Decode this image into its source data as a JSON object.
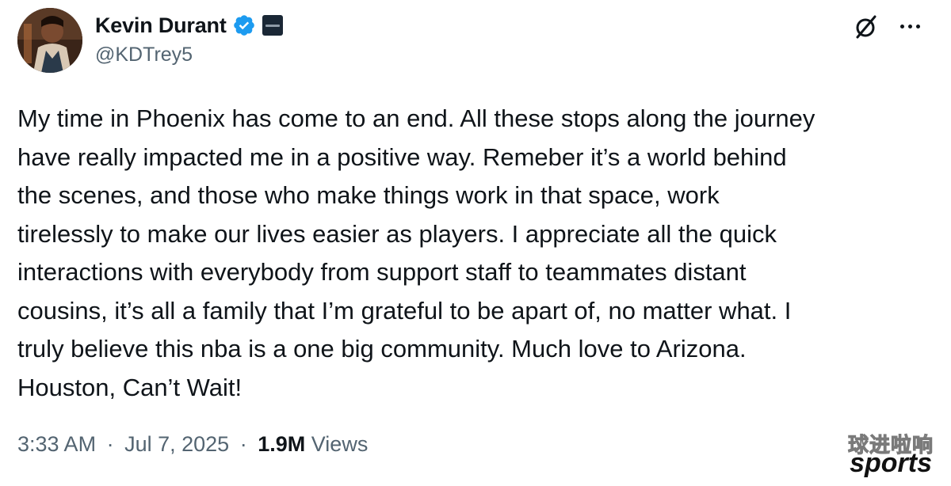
{
  "author": {
    "display_name": "Kevin Durant",
    "handle": "@KDTrey5",
    "verified": true,
    "affiliate_badge": "affiliate-badge-icon"
  },
  "header_actions": {
    "grok_icon": "grok-icon",
    "more_icon": "more-dots-icon"
  },
  "tweet": {
    "text_lines": [
      "My time in Phoenix has come to an end. All these stops along the journey",
      "have really impacted me in a positive way. Remeber it’s a world behind",
      "the scenes, and those who make things work in that space, work",
      "tirelessly to make our lives easier as players. I appreciate all the quick",
      "interactions with everybody from support staff to teammates distant",
      "cousins, it’s all a family that I’m grateful to be apart of, no matter what. I",
      "truly believe this nba is a one big community. Much love to Arizona.",
      "Houston, Can’t Wait!"
    ],
    "time": "3:33 AM",
    "date": "Jul 7, 2025",
    "views_count": "1.9M",
    "views_label": "Views",
    "separator": "·"
  },
  "watermark": {
    "text_cn": "球进啦响",
    "text_en": "sports"
  },
  "colors": {
    "text_primary": "#0f1419",
    "text_secondary": "#536471",
    "verified_blue": "#1d9bf0",
    "background": "#ffffff"
  }
}
